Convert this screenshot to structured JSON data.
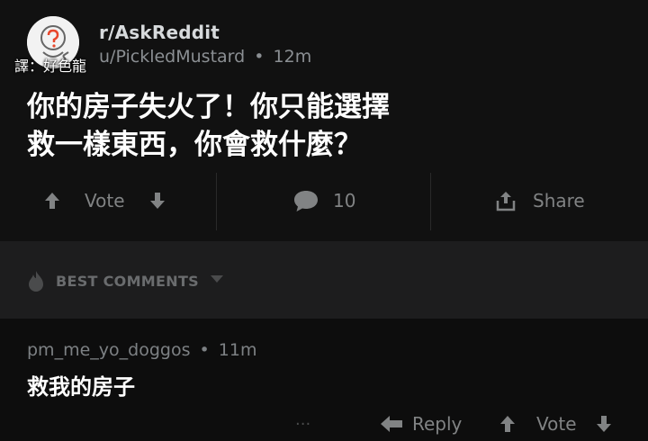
{
  "post": {
    "subreddit": "r/AskReddit",
    "author": "u/PickledMustard",
    "separator": "•",
    "age": "12m",
    "translator_credit": "譯：好色龍",
    "title_lines": [
      "你的房子失火了！你只能選擇",
      "救一樣東西，你會救什麼？"
    ],
    "actions": {
      "vote_label": "Vote",
      "comment_count": "10",
      "share_label": "Share"
    }
  },
  "comments_section": {
    "sort_label": "BEST COMMENTS"
  },
  "comment": {
    "author": "pm_me_yo_doggos",
    "separator": "•",
    "age": "11m",
    "body": "救我的房子",
    "more_label": "···",
    "reply_label": "Reply",
    "vote_label": "Vote"
  },
  "colors": {
    "background": "#0d0d0d",
    "post_background": "#111111",
    "section_bar": "#1d1d1e",
    "muted_text": "#818384",
    "primary_text": "#ffffff"
  },
  "icons": {
    "subreddit": "askreddit-question-icon",
    "upvote": "arrow-up-icon",
    "downvote": "arrow-down-icon",
    "comment": "speech-bubble-icon",
    "share": "share-icon",
    "best": "flame-icon",
    "sort": "caret-down-icon",
    "reply": "reply-arrow-icon",
    "more": "more-dots-icon"
  }
}
